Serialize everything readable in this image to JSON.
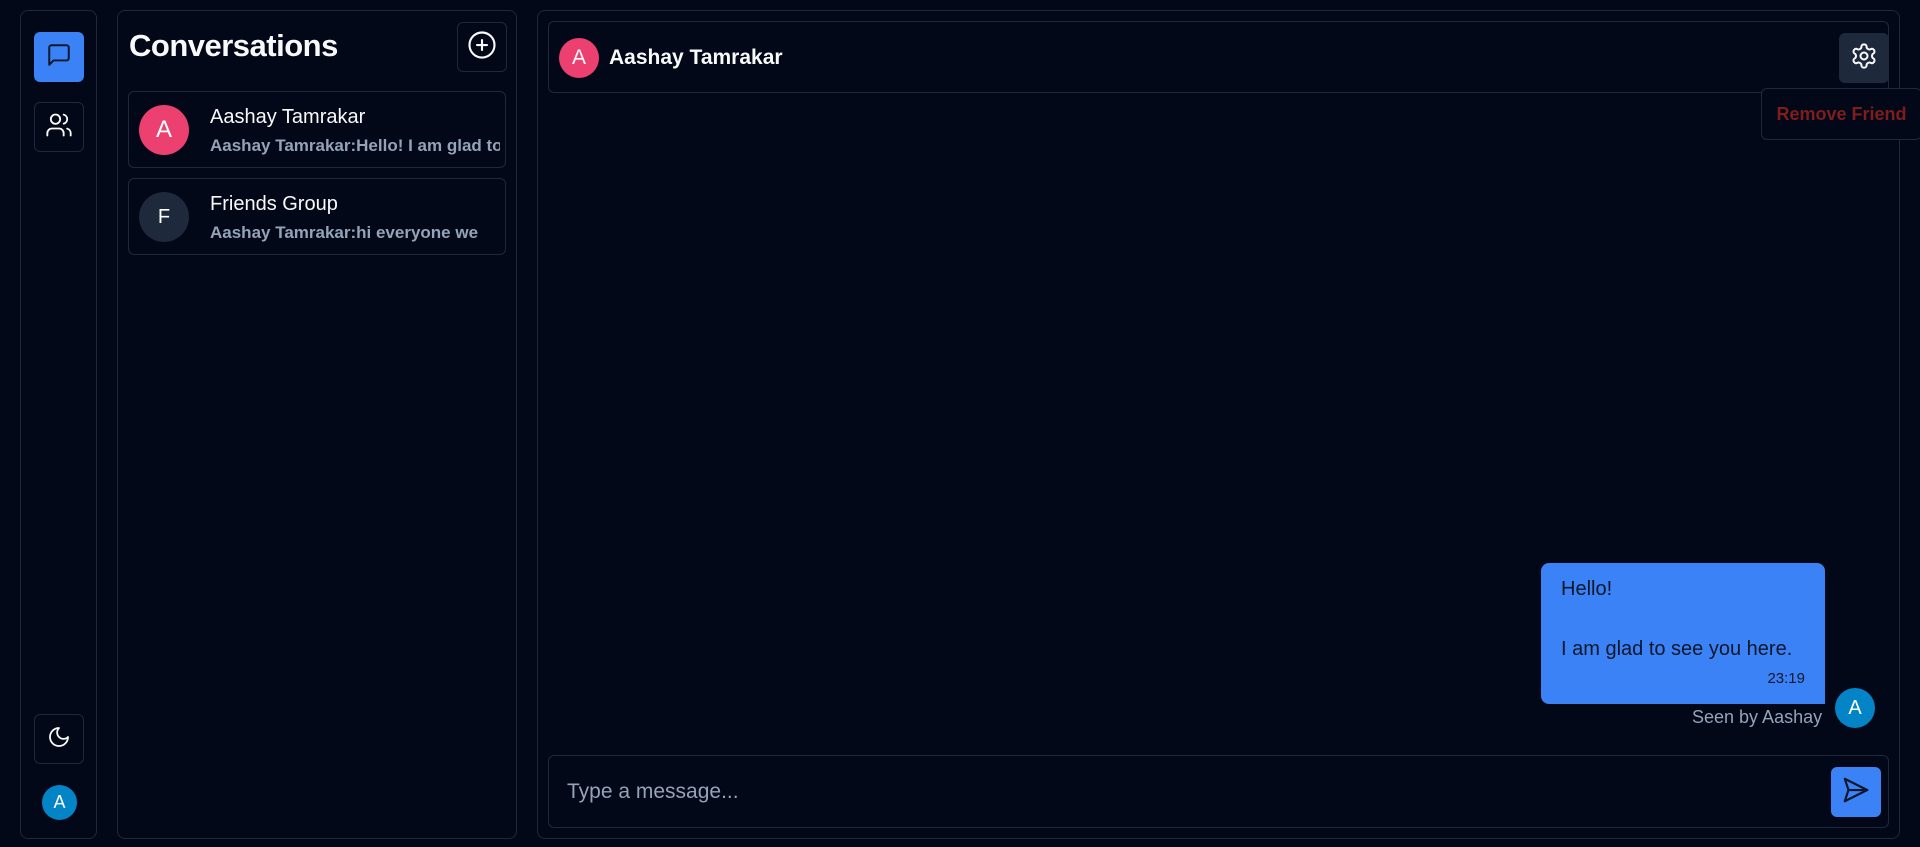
{
  "rail": {
    "chats_icon": "message-square-icon",
    "friends_icon": "users-icon",
    "theme_icon": "moon-icon",
    "user_avatar_letter": "A"
  },
  "conversations": {
    "title": "Conversations",
    "new_icon": "plus-circle-icon",
    "items": [
      {
        "avatar_letter": "A",
        "name": "Aashay Tamrakar",
        "preview": "Aashay Tamrakar:Hello! I am glad to see you here."
      },
      {
        "avatar_letter": "F",
        "name": "Friends Group",
        "preview": "Aashay Tamrakar:hi everyone we"
      }
    ]
  },
  "chat": {
    "header": {
      "avatar_letter": "A",
      "name": "Aashay Tamrakar",
      "settings_icon": "gear-icon"
    },
    "menu": {
      "remove_friend_label": "Remove Friend"
    },
    "messages": [
      {
        "line1": "Hello!",
        "line2": "I am glad to see you here.",
        "time": "23:19",
        "seen": "Seen by Aashay",
        "avatar_letter": "A"
      }
    ],
    "composer": {
      "placeholder": "Type a message...",
      "send_icon": "send-icon"
    }
  },
  "colors": {
    "background": "#020817",
    "border": "#1e293b",
    "accent": "#3b82f6",
    "avatar_pink": "#ec4070",
    "avatar_blue": "#0284c7",
    "danger": "#7f1d1d",
    "muted_text": "#94a3b8"
  }
}
